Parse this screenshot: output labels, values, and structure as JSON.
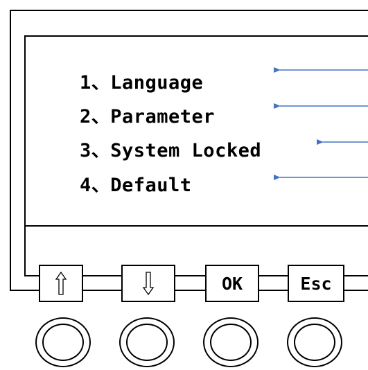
{
  "menu": {
    "items": [
      {
        "number": "1、",
        "label": "Language"
      },
      {
        "number": "2、",
        "label": "Parameter"
      },
      {
        "number": "3、",
        "label": "System Locked"
      },
      {
        "number": "4、",
        "label": "Default"
      }
    ]
  },
  "buttons": {
    "up_icon": "up-arrow-icon",
    "down_icon": "down-arrow-icon",
    "ok_label": "OK",
    "esc_label": "Esc"
  },
  "colors": {
    "pointer_arrow": "#4472c4",
    "outline": "#000000"
  }
}
